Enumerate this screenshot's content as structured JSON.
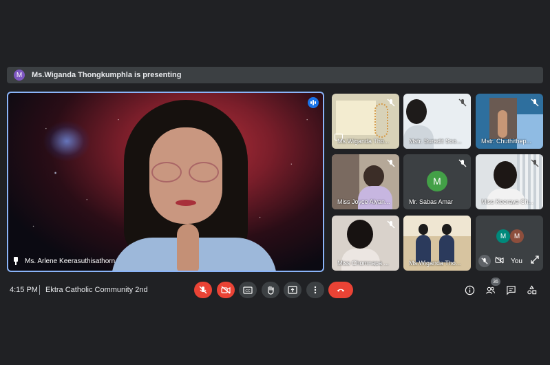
{
  "banner": {
    "avatar_letter": "M",
    "text": "Ms.Wiganda Thongkumphla is presenting"
  },
  "main_tile": {
    "name": "Ms. Arlene Keerasuthisathorn"
  },
  "tiles": [
    {
      "name": "Ms.Wiganda Tho..."
    },
    {
      "name": "Mstr. Suradit Soo..."
    },
    {
      "name": "Mstr. Chuthithep..."
    },
    {
      "name": "Miss Joyce Alyan..."
    },
    {
      "name": "Mr. Sabas Amar",
      "avatar_letter": "M",
      "avatar_color": "#43a047"
    },
    {
      "name": "Miss Keeraya Ch..."
    },
    {
      "name": "Miss Chomnapa ..."
    },
    {
      "name": "Ms.Wiganda Tho..."
    }
  ],
  "you_tile": {
    "avatar_letters": [
      "M",
      "M"
    ],
    "avatar_colors": [
      "#00897b",
      "#8d4e3c"
    ],
    "label": "You"
  },
  "bottom_bar": {
    "time": "4:15 PM",
    "meeting_name": "Ektra Catholic Community 2nd",
    "participant_count": "36",
    "controls": [
      "mic-off-icon",
      "camera-off-icon",
      "captions-icon",
      "raise-hand-icon",
      "present-icon",
      "more-icon",
      "end-call-icon"
    ],
    "right_icons": [
      "info-icon",
      "people-icon",
      "chat-icon",
      "activities-icon"
    ]
  },
  "colors": {
    "accent": "#8ab4f8",
    "danger": "#ea4335",
    "surface": "#3c4043",
    "background": "#202124"
  }
}
